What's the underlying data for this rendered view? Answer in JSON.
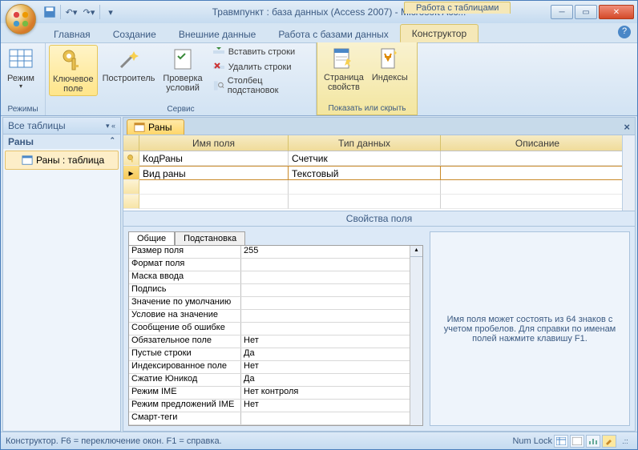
{
  "title": "Травмпункт : база данных (Access 2007) - Microsoft Acc...",
  "context_tab_title": "Работа с таблицами",
  "ribbon_tabs": [
    "Главная",
    "Создание",
    "Внешние данные",
    "Работа с базами данных",
    "Конструктор"
  ],
  "ribbon": {
    "mode": {
      "label": "Режим",
      "group": "Режимы"
    },
    "key": {
      "label": "Ключевое\nполе"
    },
    "builder": {
      "label": "Построитель"
    },
    "test": {
      "label": "Проверка\nусловий"
    },
    "insert_rows": "Вставить строки",
    "delete_rows": "Удалить строки",
    "lookup_col": "Столбец подстановок",
    "service_group": "Сервис",
    "prop_page": {
      "label": "Страница\nсвойств"
    },
    "indexes": {
      "label": "Индексы"
    },
    "show_group": "Показать или скрыть"
  },
  "nav": {
    "header": "Все таблицы",
    "group": "Раны",
    "item": "Раны : таблица"
  },
  "doc_tab": "Раны",
  "grid": {
    "col_name": "Имя поля",
    "col_type": "Тип данных",
    "col_desc": "Описание",
    "rows": [
      {
        "name": "КодРаны",
        "type": "Счетчик",
        "pk": true
      },
      {
        "name": "Вид раны",
        "type": "Текстовый",
        "pk": false
      }
    ]
  },
  "props": {
    "title": "Свойства поля",
    "tab_general": "Общие",
    "tab_lookup": "Подстановка",
    "rows": [
      {
        "k": "Размер поля",
        "v": "255"
      },
      {
        "k": "Формат поля",
        "v": ""
      },
      {
        "k": "Маска ввода",
        "v": ""
      },
      {
        "k": "Подпись",
        "v": ""
      },
      {
        "k": "Значение по умолчанию",
        "v": ""
      },
      {
        "k": "Условие на значение",
        "v": ""
      },
      {
        "k": "Сообщение об ошибке",
        "v": ""
      },
      {
        "k": "Обязательное поле",
        "v": "Нет"
      },
      {
        "k": "Пустые строки",
        "v": "Да"
      },
      {
        "k": "Индексированное поле",
        "v": "Нет"
      },
      {
        "k": "Сжатие Юникод",
        "v": "Да"
      },
      {
        "k": "Режим IME",
        "v": "Нет контроля"
      },
      {
        "k": "Режим предложений IME",
        "v": "Нет"
      },
      {
        "k": "Смарт-теги",
        "v": ""
      }
    ],
    "help": "Имя поля может состоять из 64 знаков с учетом пробелов.  Для справки по именам полей нажмите клавишу F1."
  },
  "status": {
    "left": "Конструктор.  F6 = переключение окон.  F1 = справка.",
    "numlock": "Num Lock"
  }
}
